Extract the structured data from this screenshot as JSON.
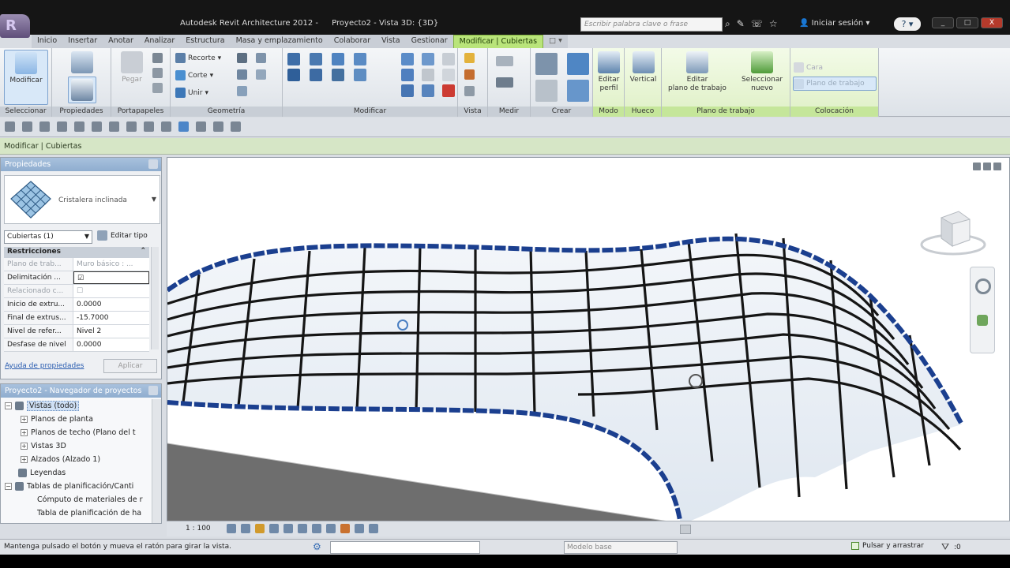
{
  "titlebar": {
    "app": "Autodesk Revit Architecture 2012 -",
    "doc": "Proyecto2 - Vista 3D: {3D}",
    "search_placeholder": "Escribir palabra clave o frase",
    "signin": "Iniciar sesión",
    "help": "?",
    "minimize": "_",
    "maximize": "□",
    "close": "X"
  },
  "tabs": [
    "Inicio",
    "Insertar",
    "Anotar",
    "Analizar",
    "Estructura",
    "Masa y emplazamiento",
    "Colaborar",
    "Vista",
    "Gestionar",
    "Modificar | Cubiertas"
  ],
  "tab_extra": "□ ▾",
  "ribbon": {
    "modify": "Modificar",
    "paste": "Pegar",
    "cut_geom": "Recorte",
    "cut2": "Corte",
    "join": "Unir",
    "edit_profile_1": "Editar",
    "edit_profile_2": "perfil",
    "vertical": "Vertical",
    "edit_plane_1": "Editar",
    "edit_plane_2": "plano de trabajo",
    "pick_new_1": "Seleccionar",
    "pick_new_2": "nuevo",
    "face": "Cara",
    "work_plane": "Plano de trabajo",
    "panels": {
      "select": "Seleccionar",
      "properties": "Propiedades",
      "clipboard": "Portapapeles",
      "geometry": "Geometría",
      "modify": "Modificar",
      "view": "Vista",
      "measure": "Medir",
      "create": "Crear",
      "mode": "Modo",
      "opening": "Hueco",
      "workplane": "Plano de trabajo",
      "placement": "Colocación"
    }
  },
  "optionsbar": "Modificar | Cubiertas",
  "properties": {
    "title": "Propiedades",
    "type_name": "Cristalera inclinada",
    "category": "Cubiertas (1)",
    "edit_type": "Editar tipo",
    "group": "Restricciones",
    "rows": [
      {
        "k": "Plano de trab...",
        "v": "Muro básico : ..."
      },
      {
        "k": "Delimitación ...",
        "v": "☑"
      },
      {
        "k": "Relacionado c...",
        "v": "☐"
      },
      {
        "k": "Inicio de extru...",
        "v": "0.0000"
      },
      {
        "k": "Final de extrus...",
        "v": "-15.7000"
      },
      {
        "k": "Nivel de refer...",
        "v": "Nivel 2"
      },
      {
        "k": "Desfase de nivel",
        "v": "0.0000"
      }
    ],
    "help_link": "Ayuda de propiedades",
    "apply": "Aplicar"
  },
  "browser": {
    "title": "Proyecto2 - Navegador de proyectos",
    "nodes": [
      {
        "label": "Vistas (todo)",
        "level": 0,
        "toggle": "−"
      },
      {
        "label": "Planos de planta",
        "level": 1,
        "toggle": "+"
      },
      {
        "label": "Planos de techo (Plano del t",
        "level": 1,
        "toggle": "+"
      },
      {
        "label": "Vistas 3D",
        "level": 1,
        "toggle": "+"
      },
      {
        "label": "Alzados (Alzado 1)",
        "level": 1,
        "toggle": "+"
      },
      {
        "label": "Leyendas",
        "level": 0,
        "toggle": ""
      },
      {
        "label": "Tablas de planificación/Canti",
        "level": 0,
        "toggle": "−"
      },
      {
        "label": "Cómputo de materiales de r",
        "level": 1,
        "toggle": ""
      },
      {
        "label": "Tabla de planificación de ha",
        "level": 1,
        "toggle": ""
      }
    ]
  },
  "viewport": {
    "scale": "1 : 100"
  },
  "statusbar": {
    "text": "Mantenga pulsado el botón y mueva el ratón para girar la vista.",
    "model": "Modelo base",
    "press_drag": "Pulsar y arrastrar",
    "filter_count": ":0"
  }
}
